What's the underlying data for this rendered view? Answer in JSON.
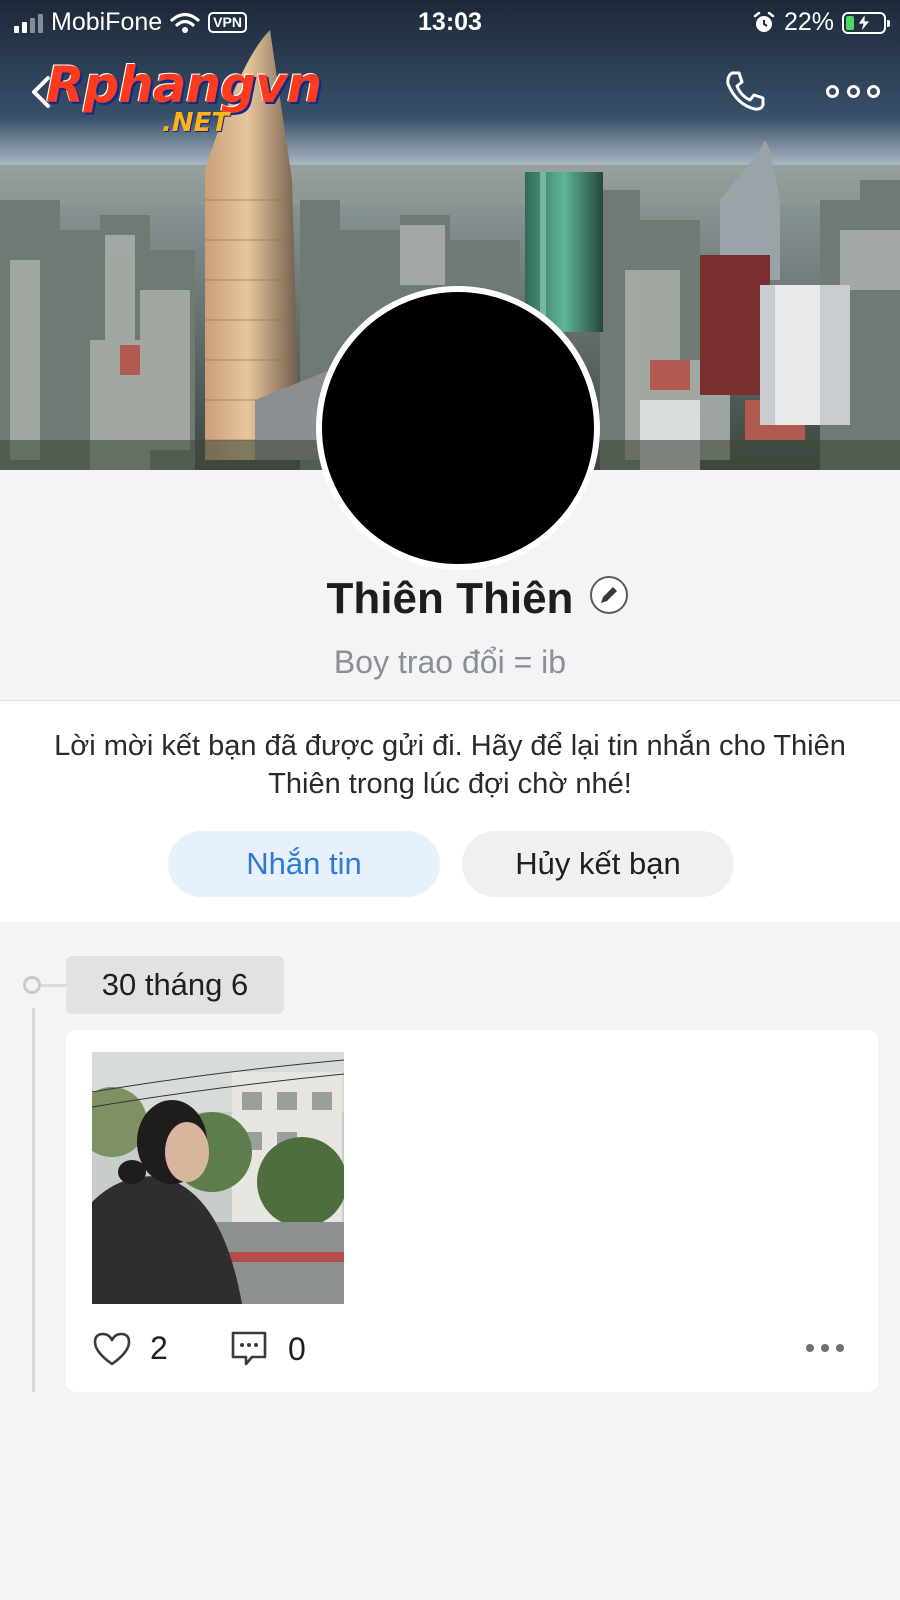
{
  "status_bar": {
    "carrier": "MobiFone",
    "vpn": "VPN",
    "time": "13:03",
    "battery": "22%",
    "battery_level": 0.22
  },
  "watermark": {
    "line1": "Rphangvn",
    "line2": ".NET"
  },
  "profile": {
    "name": "Thiên Thiên",
    "bio": "Boy trao đổi = ib"
  },
  "friend_request": {
    "message": "Lời mời kết bạn đã được gửi đi. Hãy để lại tin nhắn cho Thiên Thiên trong lúc đợi chờ nhé!",
    "message_button": "Nhắn tin",
    "cancel_button": "Hủy kết bạn"
  },
  "timeline": {
    "date": "30 tháng 6",
    "post": {
      "likes": "2",
      "comments": "0"
    }
  },
  "colors": {
    "accent": "#2f7ad6",
    "accent_bg": "#e6f1fd",
    "page_bg": "#f4f4f6",
    "battery_green": "#4cd964"
  },
  "icons": [
    "back-icon",
    "phone-icon",
    "more-icon",
    "edit-icon",
    "heart-icon",
    "comment-icon",
    "wifi-icon",
    "alarm-icon",
    "signal-icon",
    "battery-icon"
  ]
}
